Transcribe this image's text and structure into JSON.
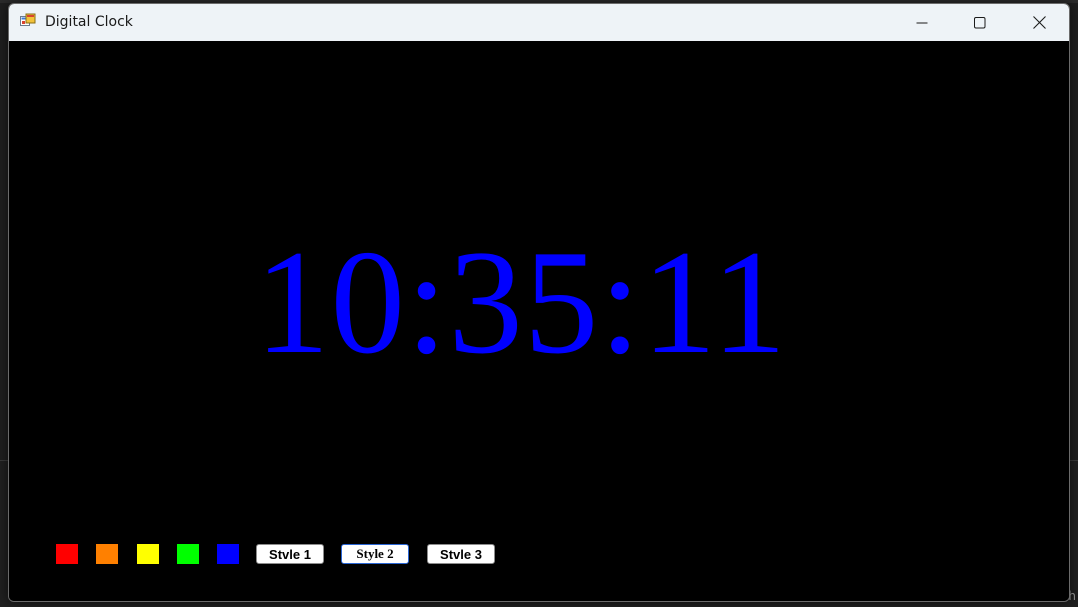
{
  "window": {
    "title": "Digital Clock"
  },
  "clock": {
    "time": "10:35:11",
    "color": "#0000ff"
  },
  "color_swatches": [
    {
      "name": "red",
      "color": "#ff0000"
    },
    {
      "name": "orange",
      "color": "#ff8000"
    },
    {
      "name": "yellow",
      "color": "#ffff00"
    },
    {
      "name": "green",
      "color": "#00ff00"
    },
    {
      "name": "blue",
      "color": "#0000ff"
    }
  ],
  "style_buttons": [
    {
      "label": "Stvle 1"
    },
    {
      "label": "Style 2"
    },
    {
      "label": "Stvle 3"
    }
  ],
  "icons": {
    "app": "app-window-icon",
    "minimize": "minimize-icon",
    "maximize": "maximize-icon",
    "close": "close-icon"
  },
  "desktop": {
    "corner_text": "oh"
  }
}
